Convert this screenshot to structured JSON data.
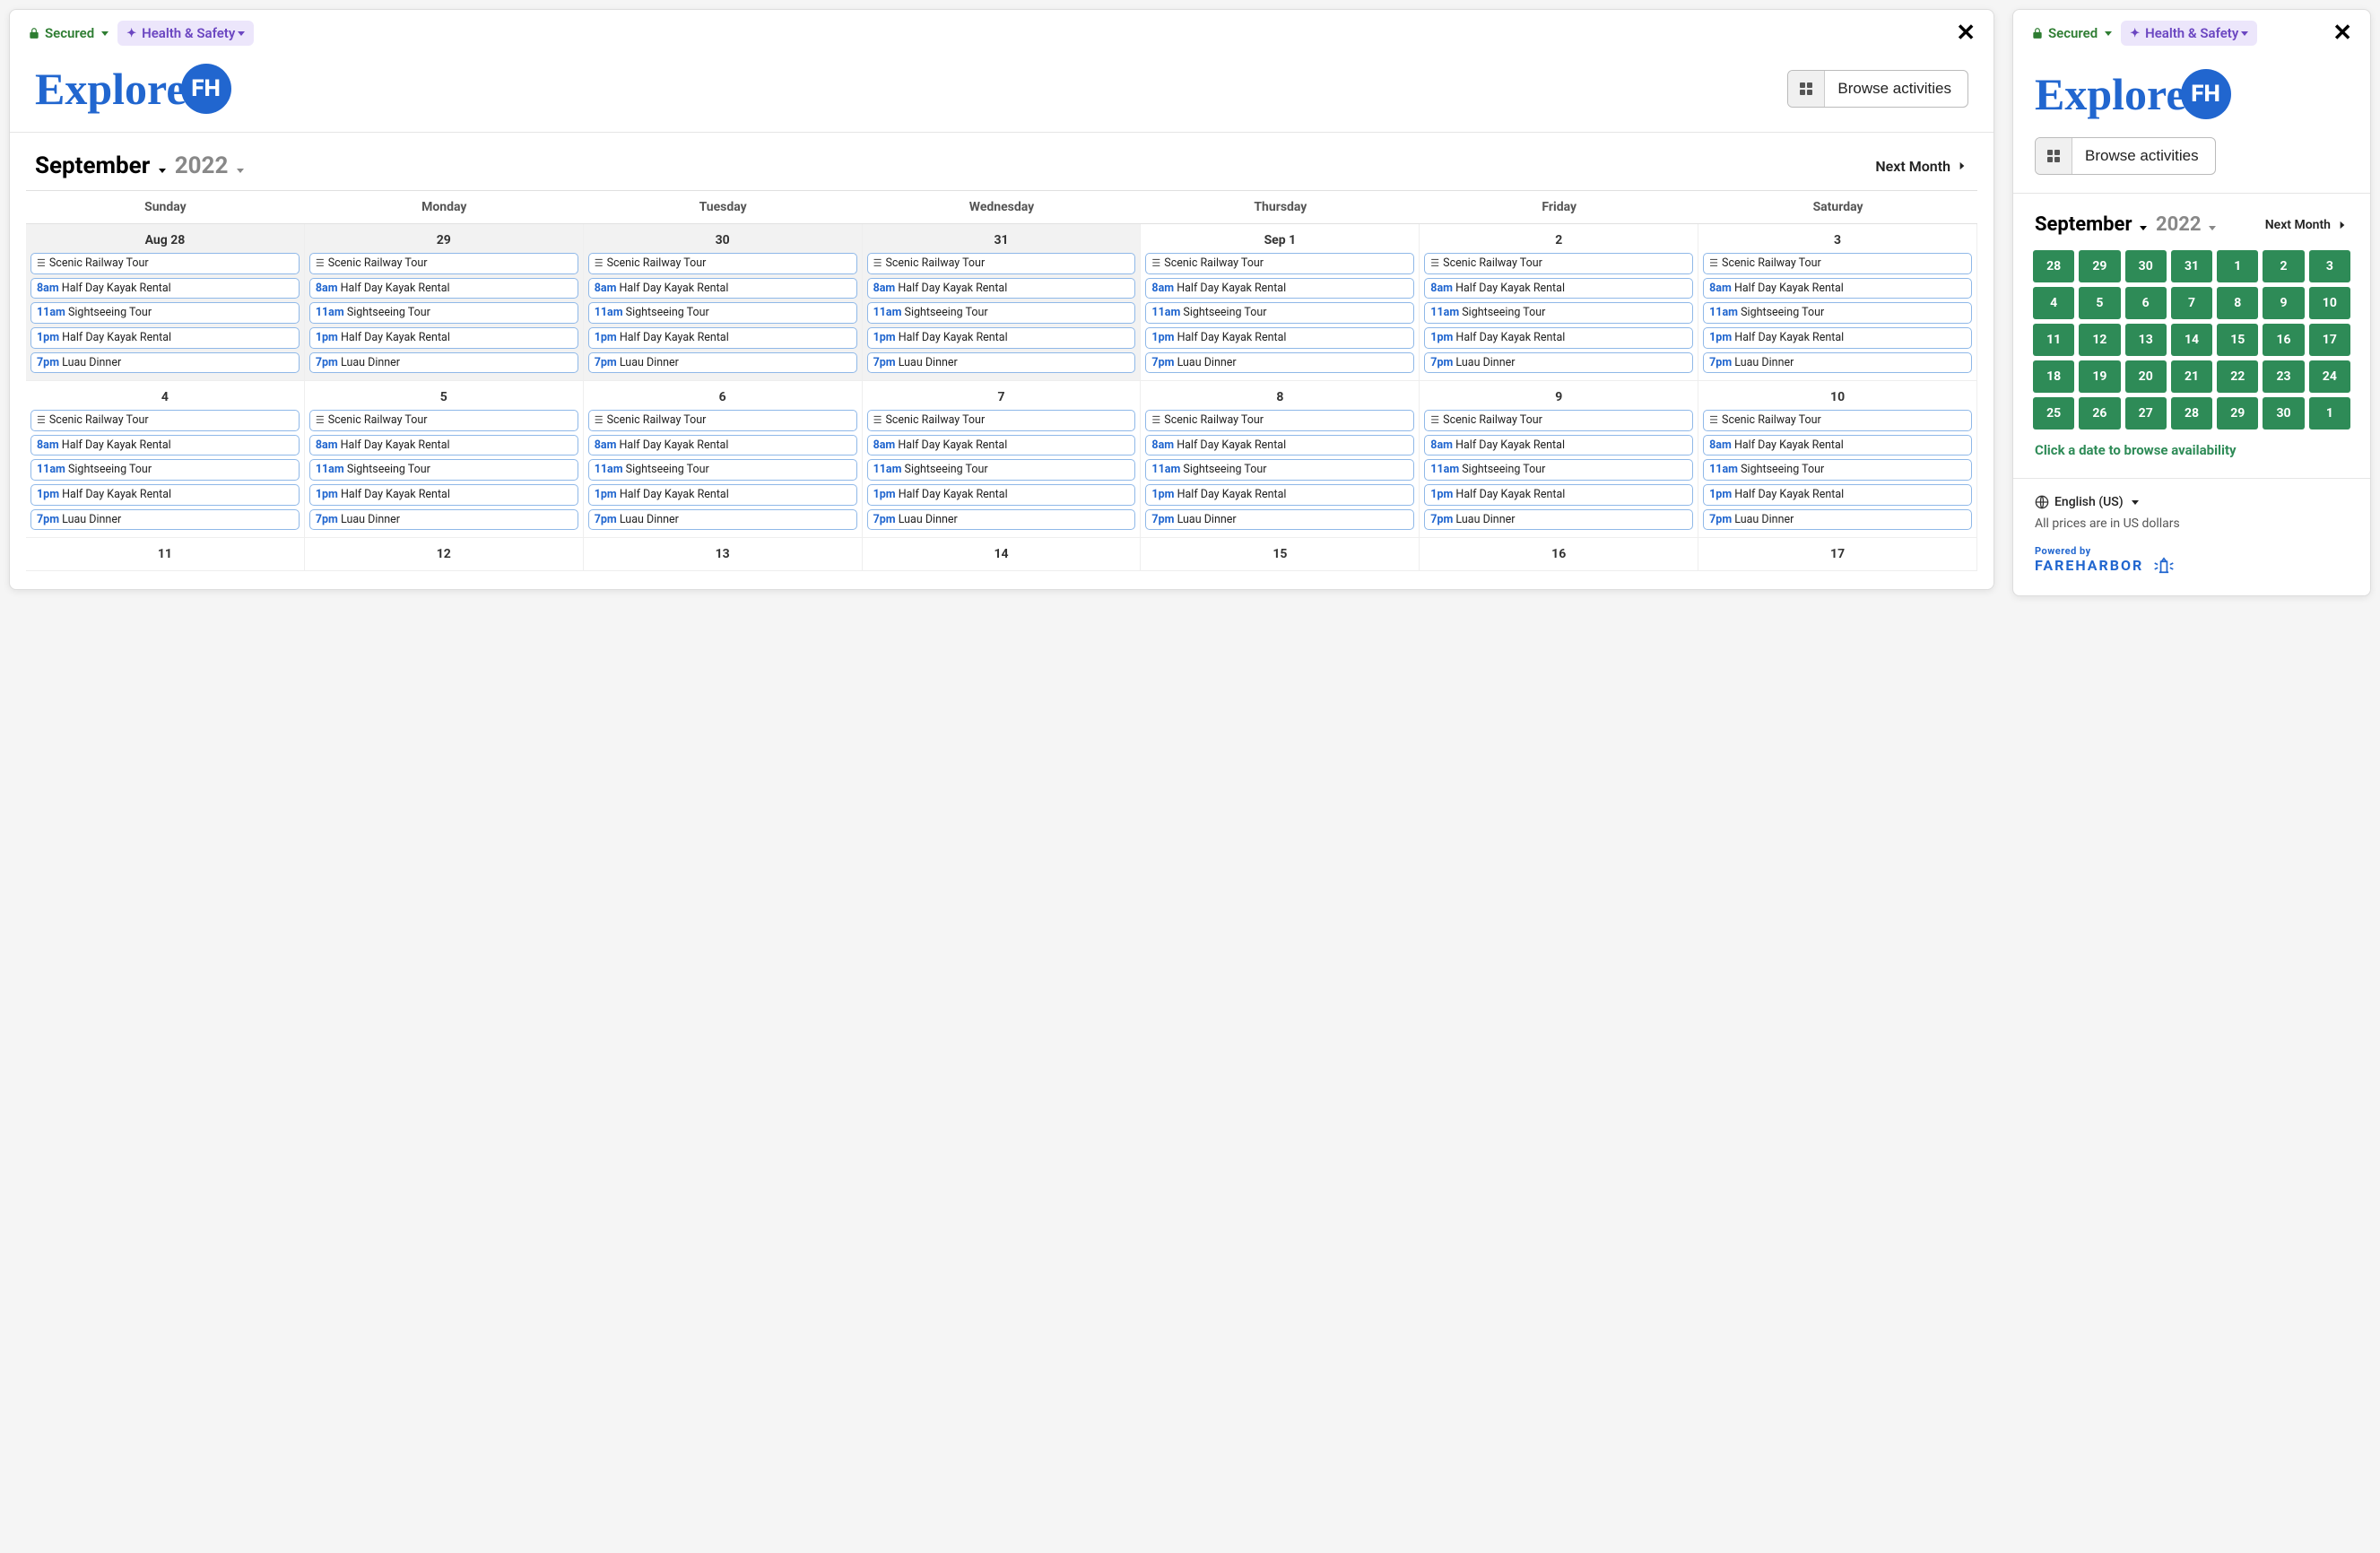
{
  "topbar": {
    "secured": "Secured",
    "health": "Health & Safety"
  },
  "browse_label": "Browse activities",
  "month_nav": {
    "month": "September",
    "year": "2022",
    "next": "Next Month"
  },
  "week_days": [
    "Sunday",
    "Monday",
    "Tuesday",
    "Wednesday",
    "Thursday",
    "Friday",
    "Saturday"
  ],
  "events_template": [
    {
      "type": "allday",
      "time": "",
      "name": "Scenic Railway Tour"
    },
    {
      "type": "timed",
      "time": "8am",
      "name": "Half Day Kayak Rental"
    },
    {
      "type": "timed",
      "time": "11am",
      "name": "Sightseeing Tour"
    },
    {
      "type": "timed",
      "time": "1pm",
      "name": "Half Day Kayak Rental"
    },
    {
      "type": "timed",
      "time": "7pm",
      "name": "Luau Dinner"
    }
  ],
  "weeks": [
    {
      "dates": [
        "Aug 28",
        "29",
        "30",
        "31",
        "Sep 1",
        "2",
        "3"
      ],
      "prev_month_count": 4,
      "show_events": true
    },
    {
      "dates": [
        "4",
        "5",
        "6",
        "7",
        "8",
        "9",
        "10"
      ],
      "prev_month_count": 0,
      "show_events": true
    },
    {
      "dates": [
        "11",
        "12",
        "13",
        "14",
        "15",
        "16",
        "17"
      ],
      "prev_month_count": 0,
      "show_events": false
    }
  ],
  "mini": {
    "rows": [
      [
        "28",
        "29",
        "30",
        "31",
        "1",
        "2",
        "3"
      ],
      [
        "4",
        "5",
        "6",
        "7",
        "8",
        "9",
        "10"
      ],
      [
        "11",
        "12",
        "13",
        "14",
        "15",
        "16",
        "17"
      ],
      [
        "18",
        "19",
        "20",
        "21",
        "22",
        "23",
        "24"
      ],
      [
        "25",
        "26",
        "27",
        "28",
        "29",
        "30",
        "1"
      ]
    ],
    "hint": "Click a date to browse availability"
  },
  "footer": {
    "lang": "English (US)",
    "prices": "All prices are in US dollars",
    "powered_small": "Powered by",
    "powered_big": "FAREHARBOR"
  }
}
